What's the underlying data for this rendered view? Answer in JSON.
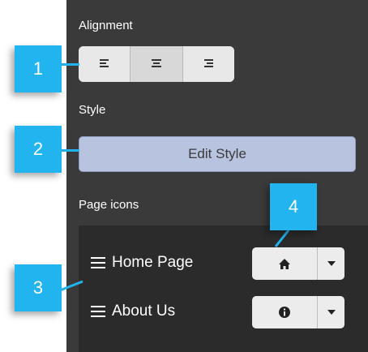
{
  "sections": {
    "alignment_label": "Alignment",
    "style_label": "Style",
    "page_icons_label": "Page icons"
  },
  "alignment": {
    "options": [
      {
        "name": "align-left",
        "icon": "align-left-icon"
      },
      {
        "name": "align-center",
        "icon": "align-center-icon",
        "active": true
      },
      {
        "name": "align-right",
        "icon": "align-right-icon"
      }
    ]
  },
  "style": {
    "edit_button_label": "Edit Style"
  },
  "page_icons": {
    "rows": [
      {
        "label": "Home Page",
        "icon": "home-icon"
      },
      {
        "label": "About Us",
        "icon": "info-icon"
      }
    ]
  },
  "callouts": [
    "1",
    "2",
    "3",
    "4"
  ],
  "colors": {
    "panel": "#3a3a3a",
    "icons_box": "#2b2b2b",
    "edit_button": "#b8c4df",
    "callout": "#22b4ee"
  }
}
